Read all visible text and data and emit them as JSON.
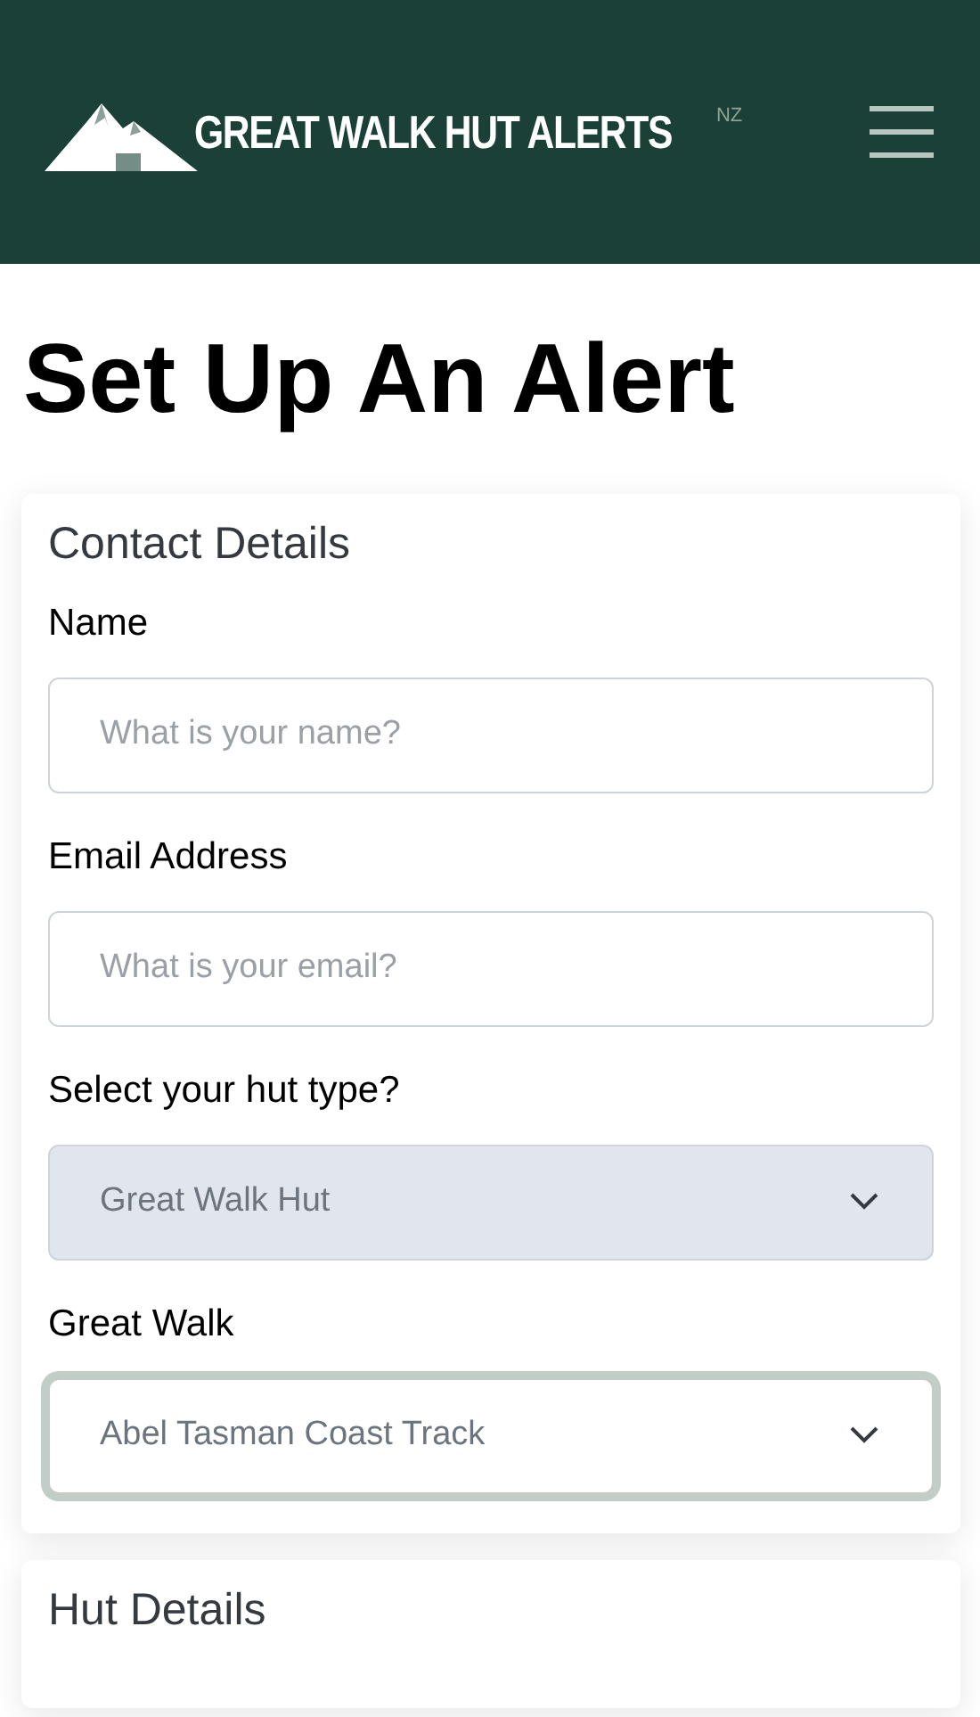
{
  "header": {
    "brand": "GREAT WALK HUT ALERTS",
    "brand_sup": "NZ"
  },
  "page_title": "Set Up An Alert",
  "sections": [
    {
      "title": "Contact Details",
      "fields": [
        {
          "kind": "text",
          "label": "Name",
          "placeholder": "What is your name?",
          "disabled": false,
          "focused": false
        },
        {
          "kind": "text",
          "label": "Email Address",
          "placeholder": "What is your email?",
          "disabled": false,
          "focused": false
        },
        {
          "kind": "select",
          "label": "Select your hut type?",
          "value": "Great Walk Hut",
          "disabled": true,
          "focused": false
        },
        {
          "kind": "select",
          "label": "Great Walk",
          "value": "Abel Tasman Coast Track",
          "disabled": false,
          "focused": true
        }
      ]
    },
    {
      "title": "Hut Details"
    }
  ]
}
